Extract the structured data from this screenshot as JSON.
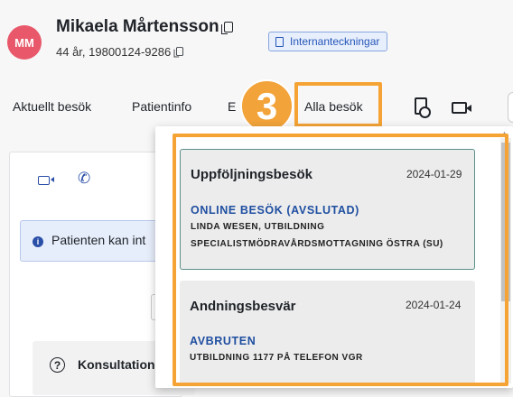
{
  "patient": {
    "initials": "MM",
    "name": "Mikaela Mårtensson",
    "info": "44 år, 19800124-9286"
  },
  "header": {
    "notes_label": "Internanteckningar"
  },
  "tabs": [
    {
      "label": "Aktuellt besök"
    },
    {
      "label": "Patientinfo"
    },
    {
      "label": "E"
    },
    {
      "label": "Alla besök"
    }
  ],
  "annotation": {
    "step": "3"
  },
  "left_panel": {
    "info_text": "Patienten kan int",
    "consult_label": "Konsultation"
  },
  "visits": [
    {
      "title": "Uppföljningsbesök",
      "date": "2024-01-29",
      "status": "ONLINE BESÖK (AVSLUTAD)",
      "line1": "LINDA WESEN, UTBILDNING",
      "line2": "SPECIALISTMÖDRAVÅRDSMOTTAGNING ÖSTRA (SU)"
    },
    {
      "title": "Andningsbesvär",
      "date": "2024-01-24",
      "status": "AVBRUTEN",
      "line1": "UTBILDNING 1177 PÅ TELEFON VGR"
    }
  ],
  "colors": {
    "avatar": "#e8586a",
    "highlight": "#f5a335",
    "accent_blue": "#1f4fa0",
    "selected_border": "#5b8f8a"
  }
}
